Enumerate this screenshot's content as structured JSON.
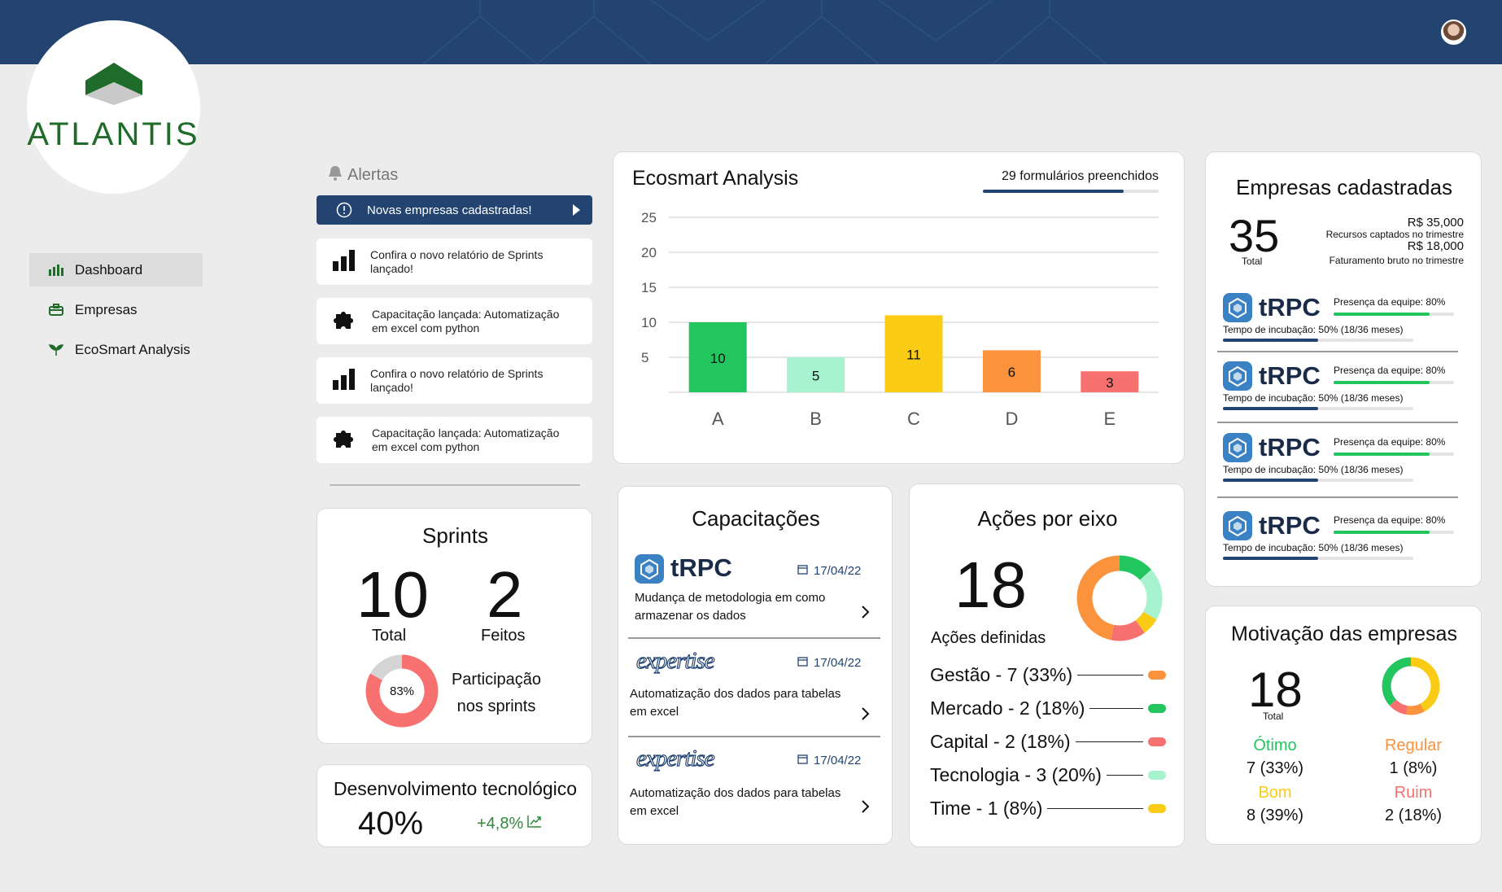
{
  "brand": {
    "name": "ATLANTIS"
  },
  "nav": {
    "items": [
      {
        "label": "Dashboard",
        "icon": "bar-chart-icon",
        "active": true
      },
      {
        "label": "Empresas",
        "icon": "briefcase-icon"
      },
      {
        "label": "EcoSmart Analysis",
        "icon": "sprout-icon"
      }
    ]
  },
  "alerts": {
    "title": "Alertas",
    "main": "Novas empresas cadastradas!",
    "items": [
      {
        "icon": "bar-chart-icon",
        "text1": "Confira o novo relatório de Sprints",
        "text2": "lançado!"
      },
      {
        "icon": "puzzle-icon",
        "text1": "Capacitação lançada: Automatização",
        "text2": "em excel com python"
      },
      {
        "icon": "bar-chart-icon",
        "text1": "Confira o novo relatório de Sprints",
        "text2": "lançado!"
      },
      {
        "icon": "puzzle-icon",
        "text1": "Capacitação lançada: Automatização",
        "text2": "em excel com python"
      }
    ]
  },
  "ecosmart": {
    "title": "Ecosmart Analysis",
    "forms": "29 formulários preenchidos",
    "forms_progress": 0.8
  },
  "chart_data": {
    "type": "bar",
    "categories": [
      "A",
      "B",
      "C",
      "D",
      "E"
    ],
    "values": [
      10,
      5,
      11,
      6,
      3
    ],
    "colors": [
      "#22c55e",
      "#a7f3d0",
      "#facc15",
      "#fb923c",
      "#f87171"
    ],
    "yticks": [
      5,
      10,
      15,
      20,
      25
    ],
    "ylim": [
      0,
      25
    ],
    "grid": true
  },
  "sprints": {
    "title": "Sprints",
    "total": "10",
    "total_label": "Total",
    "done": "2",
    "done_label": "Feitos",
    "participation": "83%",
    "participation_value": 0.83,
    "participation_label_1": "Participação",
    "participation_label_2": "nos sprints"
  },
  "devtech": {
    "title": "Desenvolvimento tecnológico",
    "value": "40%",
    "delta": "+4,8%"
  },
  "capacitacoes": {
    "title": "Capacitações",
    "items": [
      {
        "logo": "tRPC",
        "date": "17/04/22",
        "text1": "Mudança de metodologia em como",
        "text2": "armazenar os dados"
      },
      {
        "logo": "expertise",
        "date": "17/04/22",
        "text1": "Automatização dos dados para tabelas",
        "text2": "em excel"
      },
      {
        "logo": "expertise",
        "date": "17/04/22",
        "text1": "Automatização dos dados para tabelas",
        "text2": "em excel"
      }
    ]
  },
  "acoes": {
    "title": "Ações por eixo",
    "total": "18",
    "total_label": "Ações definidas",
    "legend": [
      {
        "label": "Gestão - 7 (33%)",
        "color": "#fb923c",
        "value": 7
      },
      {
        "label": "Mercado - 2 (18%)",
        "color": "#22c55e",
        "value": 2
      },
      {
        "label": "Capital - 2 (18%)",
        "color": "#f87171",
        "value": 2
      },
      {
        "label": "Tecnologia - 3 (20%)",
        "color": "#a7f3d0",
        "value": 3
      },
      {
        "label": "Time - 1 (8%)",
        "color": "#facc15",
        "value": 1
      }
    ]
  },
  "empresas": {
    "title": "Empresas cadastradas",
    "total": "35",
    "total_label": "Total",
    "raised": "R$ 35,000",
    "raised_label": "Recursos captados no trimestre",
    "revenue": "R$ 18,000",
    "revenue_label": "Faturamento bruto no trimestre",
    "companies": [
      {
        "name": "tRPC",
        "presence": "Presença da equipe: 80%",
        "presence_value": 0.8,
        "incubation": "Tempo de incubação: 50% (18/36 meses)",
        "incubation_value": 0.5
      },
      {
        "name": "tRPC",
        "presence": "Presença da equipe: 80%",
        "presence_value": 0.8,
        "incubation": "Tempo de incubação: 50% (18/36 meses)",
        "incubation_value": 0.5
      },
      {
        "name": "tRPC",
        "presence": "Presença da equipe: 80%",
        "presence_value": 0.8,
        "incubation": "Tempo de incubação: 50% (18/36 meses)",
        "incubation_value": 0.5
      },
      {
        "name": "tRPC",
        "presence": "Presença da equipe: 80%",
        "presence_value": 0.8,
        "incubation": "Tempo de incubação: 50% (18/36 meses)",
        "incubation_value": 0.5
      }
    ]
  },
  "motivacao": {
    "title": "Motivação das empresas",
    "total": "18",
    "total_label": "Total",
    "otimo": "Ótimo",
    "otimo_val": "7 (33%)",
    "regular": "Regular",
    "regular_val": "1 (8%)",
    "bom": "Bom",
    "bom_val": "8 (39%)",
    "ruim": "Ruim",
    "ruim_val": "2 (18%)"
  }
}
